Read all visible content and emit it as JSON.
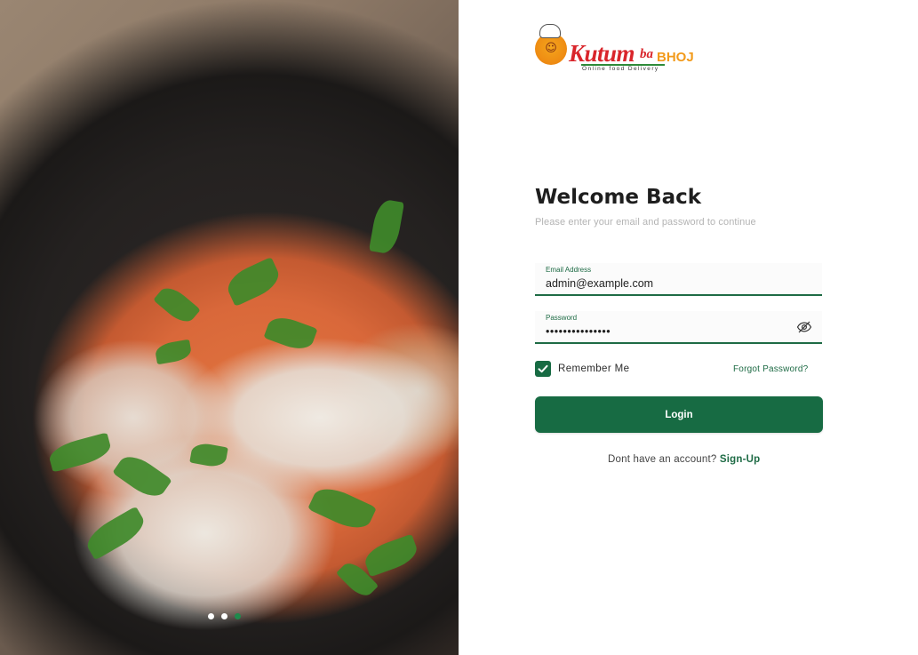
{
  "brand": {
    "name_main": "Kutum",
    "name_ba": "ba",
    "name_bhoj": "BHOJ",
    "tagline": "Online food Delivery"
  },
  "hero": {
    "carousel_dots": 3,
    "active_dot": 3
  },
  "form": {
    "title": "Welcome Back",
    "subtitle": "Please enter your email and password to continue",
    "email": {
      "label": "Email Address",
      "value": "admin@example.com"
    },
    "password": {
      "label": "Password",
      "value": "•••••••••••••••",
      "visibility_icon": "eye-off-icon"
    },
    "remember_me": {
      "label": "Remember Me",
      "checked": true
    },
    "forgot_password": "Forgot Password?",
    "login_button": "Login",
    "signup_prompt": "Dont have an account?",
    "signup_link": "Sign-Up"
  },
  "colors": {
    "primary_green": "#176b43",
    "brand_red": "#d9252b",
    "brand_orange": "#f29a1a"
  }
}
